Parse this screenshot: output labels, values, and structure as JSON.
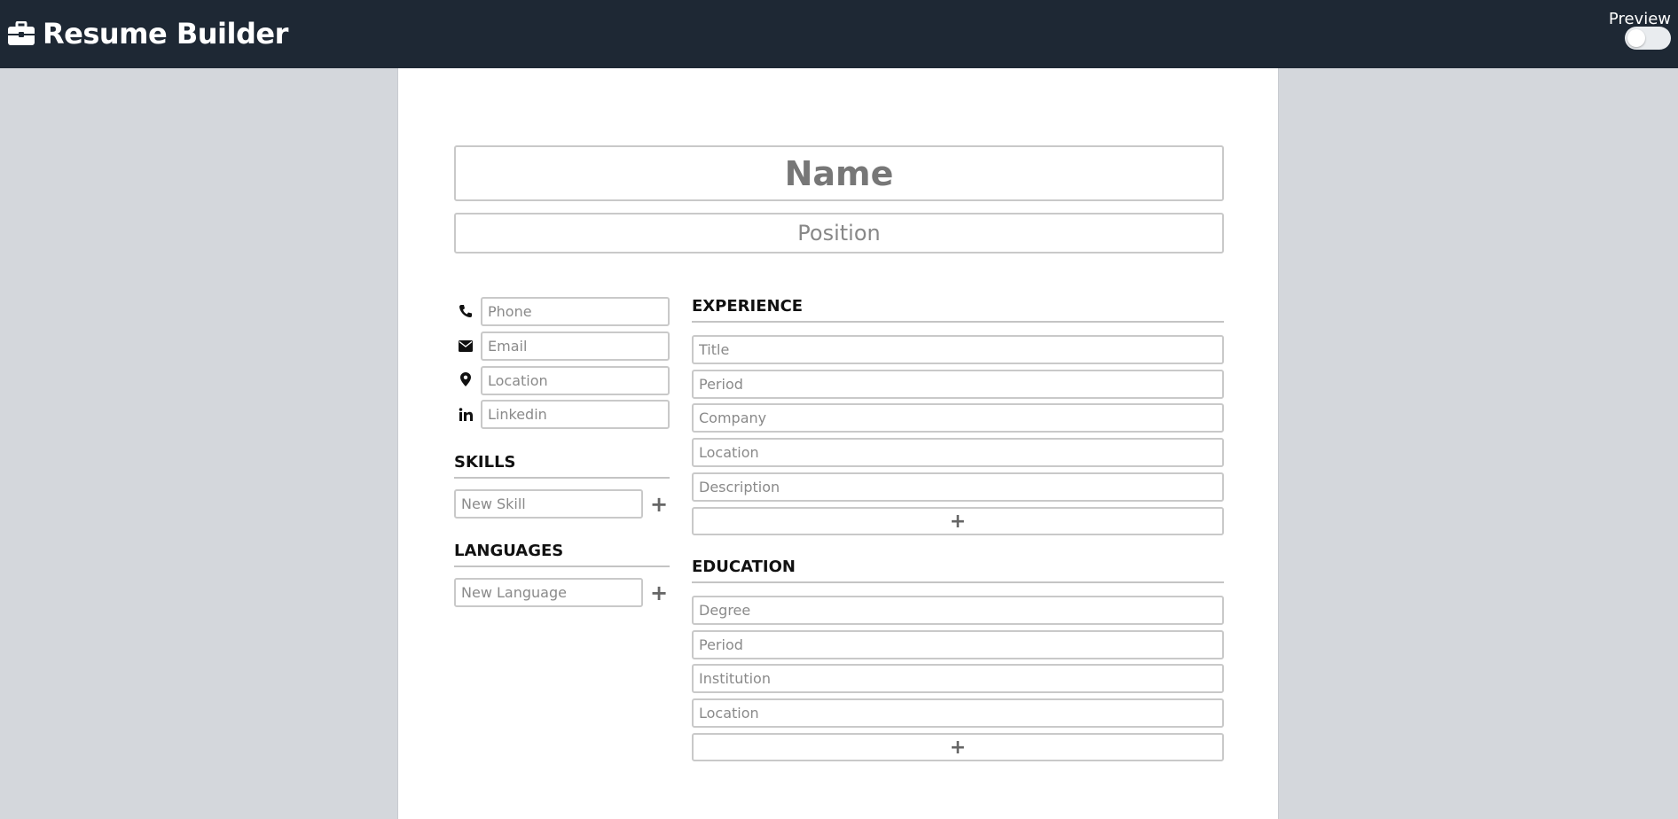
{
  "app": {
    "title": "Resume Builder",
    "preview_label": "Preview",
    "preview_enabled": false
  },
  "header_fields": {
    "name_placeholder": "Name",
    "position_placeholder": "Position"
  },
  "contact": {
    "phone_placeholder": "Phone",
    "email_placeholder": "Email",
    "location_placeholder": "Location",
    "linkedin_placeholder": "Linkedin"
  },
  "skills": {
    "title": "SKILLS",
    "placeholder": "New Skill",
    "add_label": "+"
  },
  "languages": {
    "title": "LANGUAGES",
    "placeholder": "New Language",
    "add_label": "+"
  },
  "experience": {
    "title": "EXPERIENCE",
    "title_placeholder": "Title",
    "period_placeholder": "Period",
    "company_placeholder": "Company",
    "location_placeholder": "Location",
    "description_placeholder": "Description",
    "add_label": "+"
  },
  "education": {
    "title": "EDUCATION",
    "degree_placeholder": "Degree",
    "period_placeholder": "Period",
    "institution_placeholder": "Institution",
    "location_placeholder": "Location",
    "add_label": "+"
  },
  "colors": {
    "topbar": "#1e2834",
    "page_bg": "#d4d7dc",
    "paper": "#ffffff",
    "field_border": "#c9c9c9"
  }
}
